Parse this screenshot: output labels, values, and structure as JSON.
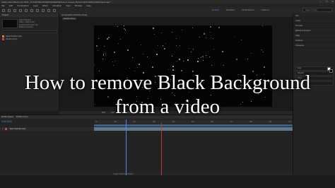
{
  "titlebar": {
    "title": "Adobe After Effects CC 2018 - D:\\CONTENTS\\NEWSCREATE\\How to remove BLACK BACKGROUND\\Project.aep *",
    "minimize": "—",
    "maximize": "☐",
    "close": "✕"
  },
  "menu": [
    "File",
    "Edit",
    "Composition",
    "Layer",
    "Effect",
    "Animation",
    "View",
    "Window",
    "Help"
  ],
  "workspaces": {
    "items": [
      "Default",
      "Standard",
      "Small Screen",
      "Libraries"
    ],
    "active_index": 0,
    "search_placeholder": "Search Help"
  },
  "project": {
    "tab": "Project",
    "meta": [
      "Stars Particles",
      "1920 x 1080 (1.00)",
      "Δ 0;00;10;00, 29.97 fps",
      "Millions of Colors"
    ],
    "items": [
      {
        "name": "Stars Particles.mp4",
        "icon": "footage-icon"
      },
      {
        "name": "Particle Comp",
        "icon": "composition-icon"
      }
    ]
  },
  "viewer": {
    "tab": "Composition Particle Comp",
    "comp_label": "Particle Comp",
    "bar": [
      "50%",
      "Full",
      "Active Camera",
      "1 View",
      "+0.0"
    ]
  },
  "right_panel": {
    "items": [
      "Info",
      "Audio",
      "Preview",
      "Effects & Presets",
      "Align",
      "Libraries",
      "Character"
    ],
    "char_rows": [
      "Arial",
      "Regular",
      "36 px",
      "Auto"
    ],
    "fill_color": "#ffffff",
    "stroke_color": "#000000"
  },
  "timeline": {
    "tabs": [
      "Render Queue",
      "Particle Comp"
    ],
    "timecode": "0;00;00;00",
    "ruler": [
      "0s",
      "01s",
      "02s",
      "03s",
      "04s",
      "05s",
      "06s",
      "07s",
      "08s",
      "09s",
      "10s"
    ],
    "layer": {
      "number": "1",
      "name": "Stars Particles.mp4"
    },
    "footer": "Toggle Switches / Modes"
  },
  "caption": {
    "line1": "How to remove Black Background",
    "line2": "from a video"
  },
  "colors": {
    "accent": "#4f8ae6",
    "text_overlay": "#ffffff",
    "playhead": "#4f8ae6",
    "work_area_end": "#c0392b"
  }
}
